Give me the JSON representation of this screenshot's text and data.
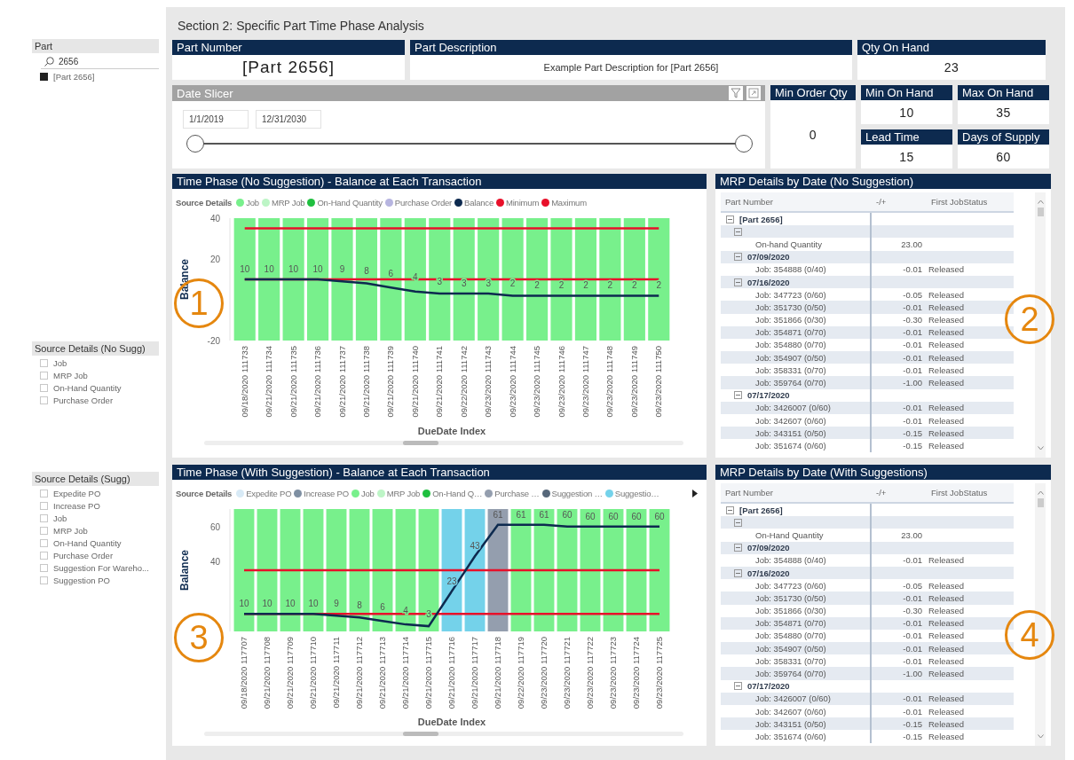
{
  "sidebar": {
    "slicers": [
      {
        "title": "Part",
        "search": {
          "value": "2656"
        },
        "items": [
          {
            "label": "[Part 2656]",
            "checked": true
          }
        ]
      },
      {
        "title": "Source Details (No Sugg)",
        "items": [
          {
            "label": "Job",
            "checked": false
          },
          {
            "label": "MRP Job",
            "checked": false
          },
          {
            "label": "On-Hand Quantity",
            "checked": false
          },
          {
            "label": "Purchase Order",
            "checked": false
          }
        ]
      },
      {
        "title": "Source Details (Sugg)",
        "items": [
          {
            "label": "Expedite PO",
            "checked": false
          },
          {
            "label": "Increase PO",
            "checked": false
          },
          {
            "label": "Job",
            "checked": false
          },
          {
            "label": "MRP Job",
            "checked": false
          },
          {
            "label": "On-Hand Quantity",
            "checked": false
          },
          {
            "label": "Purchase Order",
            "checked": false
          },
          {
            "label": "Suggestion For Wareho...",
            "checked": false
          },
          {
            "label": "Suggestion PO",
            "checked": false
          }
        ]
      }
    ]
  },
  "section_title": "Section 2: Specific Part Time Phase Analysis",
  "cards": {
    "part_number": {
      "label": "Part Number",
      "value": "[Part 2656]"
    },
    "part_description": {
      "label": "Part Description",
      "value": "Example Part Description for [Part 2656]"
    },
    "qty_on_hand": {
      "label": "Qty On Hand",
      "value": "23"
    },
    "min_order_qty": {
      "label": "Min Order Qty",
      "value": "0"
    },
    "min_on_hand": {
      "label": "Min On Hand",
      "value": "10"
    },
    "max_on_hand": {
      "label": "Max On Hand",
      "value": "35"
    },
    "lead_time": {
      "label": "Lead Time",
      "value": "15"
    },
    "days_of_supply": {
      "label": "Days of Supply",
      "value": "60"
    }
  },
  "date_slicer": {
    "title": "Date Slicer",
    "start": "1/1/2019",
    "end": "12/31/2030",
    "handles": [
      {
        "level": 0
      },
      {
        "level": 1
      }
    ]
  },
  "charts": [
    {
      "title": "Time Phase (No Suggestion) - Balance at Each Transaction",
      "legend_title": "Source Details",
      "sources": [
        {
          "label": "Job",
          "color": "#78f08c"
        },
        {
          "label": "MRP Job",
          "color": "#bdf5c6"
        },
        {
          "label": "On-Hand Quantity",
          "color": "#1fbf3f"
        },
        {
          "label": "Purchase Order",
          "color": "#b7b5e0"
        }
      ],
      "columns": [
        {
          "color": "#78f08c"
        },
        {
          "color": "#78f08c"
        },
        {
          "color": "#78f08c"
        },
        {
          "color": "#78f08c"
        },
        {
          "color": "#78f08c"
        },
        {
          "color": "#78f08c"
        },
        {
          "color": "#78f08c"
        },
        {
          "color": "#78f08c"
        },
        {
          "color": "#78f08c"
        },
        {
          "color": "#78f08c"
        },
        {
          "color": "#78f08c"
        },
        {
          "color": "#78f08c"
        },
        {
          "color": "#78f08c"
        },
        {
          "color": "#78f08c"
        },
        {
          "color": "#78f08c"
        },
        {
          "color": "#78f08c"
        },
        {
          "color": "#78f08c"
        },
        {
          "color": "#78f08c"
        }
      ],
      "chart_data": {
        "type": "line",
        "xlabel": "DueDate Index",
        "ylabel": "Balance",
        "categories": [
          "09/18/2020 111733",
          "09/21/2020 111734",
          "09/21/2020 111735",
          "09/21/2020 111736",
          "09/21/2020 111737",
          "09/21/2020 111738",
          "09/21/2020 111739",
          "09/21/2020 111740",
          "09/21/2020 111741",
          "09/22/2020 111742",
          "09/23/2020 111743",
          "09/23/2020 111744",
          "09/23/2020 111745",
          "09/23/2020 111746",
          "09/23/2020 111747",
          "09/23/2020 111748",
          "09/23/2020 111749",
          "09/23/2020 111750"
        ],
        "series": [
          {
            "name": "Balance",
            "color": "#0d2a4f",
            "values": [
              10,
              10,
              10,
              10,
              9,
              8,
              6,
              4,
              3,
              3,
              3,
              2,
              2,
              2,
              2,
              2,
              2,
              2
            ]
          }
        ],
        "ref_lines": [
          {
            "axis": "y",
            "value": 10,
            "label": "Minimum",
            "color": "#e8102a"
          },
          {
            "axis": "y",
            "value": 35,
            "label": "Maximum",
            "color": "#e8102a"
          }
        ],
        "ylim": [
          -20,
          40
        ],
        "yticks": [
          -20,
          20,
          40
        ],
        "data_labels": true
      }
    },
    {
      "title": "Time Phase (With Suggestion) - Balance at Each Transaction",
      "legend_more": true,
      "legend_title": "Source Details",
      "sources": [
        {
          "label": "Expedite PO",
          "color": "#d8eaf6"
        },
        {
          "label": "Increase PO",
          "color": "#7e8fa2"
        },
        {
          "label": "Job",
          "color": "#78f08c"
        },
        {
          "label": "MRP Job",
          "color": "#bdf5c6"
        },
        {
          "label": "On-Hand Q…",
          "color": "#1fbf3f"
        },
        {
          "label": "Purchase …",
          "color": "#949eae"
        },
        {
          "label": "Suggestion …",
          "color": "#56677a"
        },
        {
          "label": "Suggestio…",
          "color": "#74d2ea"
        }
      ],
      "columns": [
        {
          "color": "#78f08c"
        },
        {
          "color": "#78f08c"
        },
        {
          "color": "#78f08c"
        },
        {
          "color": "#78f08c"
        },
        {
          "color": "#78f08c"
        },
        {
          "color": "#78f08c"
        },
        {
          "color": "#78f08c"
        },
        {
          "color": "#78f08c"
        },
        {
          "color": "#78f08c"
        },
        {
          "color": "#74d2ea"
        },
        {
          "color": "#74d2ea"
        },
        {
          "color": "#949eae"
        },
        {
          "color": "#78f08c"
        },
        {
          "color": "#78f08c"
        },
        {
          "color": "#78f08c"
        },
        {
          "color": "#78f08c"
        },
        {
          "color": "#78f08c"
        },
        {
          "color": "#78f08c"
        },
        {
          "color": "#78f08c"
        }
      ],
      "chart_data": {
        "type": "line",
        "xlabel": "DueDate Index",
        "ylabel": "Balance",
        "categories": [
          "09/18/2020 117707",
          "09/21/2020 117708",
          "09/21/2020 117709",
          "09/21/2020 117710",
          "09/21/2020 117711",
          "09/21/2020 117712",
          "09/21/2020 117713",
          "09/21/2020 117714",
          "09/21/2020 117715",
          "09/21/2020 117716",
          "09/21/2020 117717",
          "09/21/2020 117718",
          "09/22/2020 117719",
          "09/23/2020 117720",
          "09/23/2020 117721",
          "09/23/2020 117722",
          "09/23/2020 117723",
          "09/23/2020 117724",
          "09/23/2020 117725"
        ],
        "series": [
          {
            "color": "#0d2a4f",
            "values": [
              10,
              10,
              10,
              10,
              9,
              8,
              6,
              4,
              3,
              23,
              43,
              61,
              61,
              61,
              60,
              60,
              60,
              60,
              60
            ]
          }
        ],
        "ref_lines": [
          {
            "axis": "y",
            "value": 10,
            "color": "#e8102a"
          },
          {
            "axis": "y",
            "value": 35,
            "color": "#e8102a"
          }
        ],
        "ylim": [
          0,
          70
        ],
        "yticks": [
          40,
          60
        ],
        "data_labels": true
      }
    }
  ],
  "tables": [
    {
      "title": "MRP Details by Date (No Suggestion)",
      "columns": [
        "Part Number",
        "-/+",
        "First JobStatus"
      ],
      "rows": [
        {
          "label": "[Part 2656]",
          "expanded": true,
          "children": [
            {
              "expanded": true,
              "children": [
                {
                  "label": "On-hand Quantity",
                  "value": "23.00"
                }
              ]
            },
            {
              "label": "07/09/2020",
              "expanded": true,
              "children": [
                {
                  "label": "Job: 354888 (0/40)",
                  "value": "-0.01",
                  "status": "Released"
                }
              ]
            },
            {
              "label": "07/16/2020",
              "expanded": true,
              "children": [
                {
                  "label": "Job: 347723 (0/60)",
                  "value": "-0.05",
                  "status": "Released"
                },
                {
                  "label": "Job: 351730 (0/50)",
                  "value": "-0.01",
                  "status": "Released"
                },
                {
                  "label": "Job: 351866 (0/30)",
                  "value": "-0.30",
                  "status": "Released"
                },
                {
                  "label": "Job: 354871 (0/70)",
                  "value": "-0.01",
                  "status": "Released"
                },
                {
                  "label": "Job: 354880 (0/70)",
                  "value": "-0.01",
                  "status": "Released"
                },
                {
                  "label": "Job: 354907 (0/50)",
                  "value": "-0.01",
                  "status": "Released"
                },
                {
                  "label": "Job: 358331 (0/70)",
                  "value": "-0.01",
                  "status": "Released"
                },
                {
                  "label": "Job: 359764 (0/70)",
                  "value": "-1.00",
                  "status": "Released"
                }
              ]
            },
            {
              "label": "07/17/2020",
              "expanded": true,
              "children": [
                {
                  "label": "Job: 3426007 (0/60)",
                  "value": "-0.01",
                  "status": "Released"
                },
                {
                  "label": "Job: 342607 (0/60)",
                  "value": "-0.01",
                  "status": "Released"
                },
                {
                  "label": "Job: 343151 (0/50)",
                  "value": "-0.15",
                  "status": "Released"
                },
                {
                  "label": "Job: 351674 (0/60)",
                  "value": "-0.15",
                  "status": "Released"
                }
              ]
            }
          ]
        }
      ]
    },
    {
      "title": "MRP Details by Date (With Suggestions)",
      "columns": [
        "Part Number",
        "-/+",
        "First JobStatus"
      ],
      "rows": [
        {
          "label": "[Part 2656]",
          "expanded": true,
          "children": [
            {
              "expanded": true,
              "children": [
                {
                  "label": "On-Hand Quantity",
                  "value": "23.00"
                }
              ]
            },
            {
              "label": "07/09/2020",
              "expanded": true,
              "children": [
                {
                  "label": "Job: 354888 (0/40)",
                  "value": "-0.01",
                  "status": "Released"
                }
              ]
            },
            {
              "label": "07/16/2020",
              "expanded": true,
              "children": [
                {
                  "label": "Job: 347723 (0/60)",
                  "value": "-0.05",
                  "status": "Released"
                },
                {
                  "label": "Job: 351730 (0/50)",
                  "value": "-0.01",
                  "status": "Released"
                },
                {
                  "label": "Job: 351866 (0/30)",
                  "value": "-0.30",
                  "status": "Released"
                },
                {
                  "label": "Job: 354871 (0/70)",
                  "value": "-0.01",
                  "status": "Released"
                },
                {
                  "label": "Job: 354880 (0/70)",
                  "value": "-0.01",
                  "status": "Released"
                },
                {
                  "label": "Job: 354907 (0/50)",
                  "value": "-0.01",
                  "status": "Released"
                },
                {
                  "label": "Job: 358331 (0/70)",
                  "value": "-0.01",
                  "status": "Released"
                },
                {
                  "label": "Job: 359764 (0/70)",
                  "value": "-1.00",
                  "status": "Released"
                }
              ]
            },
            {
              "label": "07/17/2020",
              "expanded": true,
              "children": [
                {
                  "label": "Job: 3426007 (0/60)",
                  "value": "-0.01",
                  "status": "Released"
                },
                {
                  "label": "Job: 342607 (0/60)",
                  "value": "-0.01",
                  "status": "Released"
                },
                {
                  "label": "Job: 343151 (0/50)",
                  "value": "-0.15",
                  "status": "Released"
                },
                {
                  "label": "Job: 351674 (0/60)",
                  "value": "-0.15",
                  "status": "Released"
                }
              ]
            }
          ]
        }
      ]
    }
  ],
  "callouts": [
    {
      "label": "1"
    },
    {
      "label": "2"
    },
    {
      "label": "3"
    },
    {
      "label": "4"
    }
  ]
}
